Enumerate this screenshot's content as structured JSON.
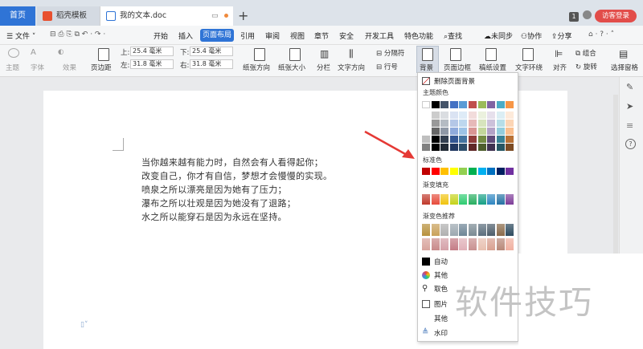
{
  "tabs": {
    "home": "首页",
    "template": "稻壳模板",
    "document": "我的文本.doc",
    "new_tab": "+"
  },
  "titlebar": {
    "badge": "1",
    "visitor_login": "访客登录"
  },
  "menu": {
    "file": "文件",
    "items": [
      "开始",
      "插入",
      "页面布局",
      "引用",
      "审阅",
      "视图",
      "章节",
      "安全",
      "开发工具",
      "特色功能"
    ],
    "search": "查找",
    "sync": "未同步",
    "collab": "协作",
    "share": "分享"
  },
  "ribbon": {
    "theme": "主题",
    "font": "字体",
    "effect": "效果",
    "margins": "页边距",
    "top_label": "上:",
    "top_value": "25.4 毫米",
    "bottom_label": "下:",
    "bottom_value": "25.4 毫米",
    "left_label": "左:",
    "left_value": "31.8 毫米",
    "right_label": "右:",
    "right_value": "31.8 毫米",
    "orientation": "纸张方向",
    "size": "纸张大小",
    "columns": "分栏",
    "text_direction": "文字方向",
    "section_break": "分隔符",
    "line_numbers": "行号",
    "background": "背景",
    "page_border": "页面边框",
    "paper_setup": "稿纸设置",
    "text_wrap": "文字环绕",
    "align": "对齐",
    "group": "组合",
    "rotate": "旋转",
    "selection_pane": "选择窗格"
  },
  "document": {
    "lines": [
      "当你越来越有能力时，自然会有人看得起你；",
      "改变自己，你才有自信，梦想才会慢慢的实现。",
      "喷泉之所以漂亮是因为她有了压力；",
      "瀑布之所以壮观是因为她没有了退路；",
      "水之所以能穿石是因为永远在坚持。"
    ]
  },
  "dropdown": {
    "remove_background": "删除页面背景",
    "theme_colors": "主题颜色",
    "standard_colors": "标准色",
    "gradient_fill": "渐变填充",
    "gradient_recommend": "渐变色推荐",
    "auto": "自动",
    "more_colors": "其他",
    "picker": "取色",
    "picture": "图片",
    "other": "其他",
    "watermark": "水印",
    "theme_top_row": [
      "#ffffff",
      "#000000",
      "#44546a",
      "#4472c4",
      "#5b9bd5",
      "#c0504d",
      "#9bbb59",
      "#8064a2",
      "#4bacc6",
      "#f79646"
    ],
    "standard_row": [
      "#c00000",
      "#ff0000",
      "#ffc000",
      "#ffff00",
      "#92d050",
      "#00b050",
      "#00b0f0",
      "#0070c0",
      "#002060",
      "#7030a0"
    ],
    "gradient_row": [
      "#c0392b",
      "#e74c3c",
      "#f1c40f",
      "#c5d31a",
      "#2ecc71",
      "#27ae60",
      "#16a085",
      "#2e86c1",
      "#2471a3",
      "#7d3c98"
    ],
    "recommend_row1": [
      "#b8913c",
      "#c9a15a",
      "#b0b0b0",
      "#9ca8b0",
      "#6e8696",
      "#7b8b94",
      "#5c6f7d",
      "#4e5e6a",
      "#8a6a4a",
      "#2d4a5e"
    ],
    "recommend_row2": [
      "#d8a49c",
      "#c88a8a",
      "#d4a0a8",
      "#c47c86",
      "#e0b0b8",
      "#c89090",
      "#e8c0b0",
      "#d8a090",
      "#b88878",
      "#f0b0a0"
    ]
  },
  "watermark_text": "软件技巧"
}
